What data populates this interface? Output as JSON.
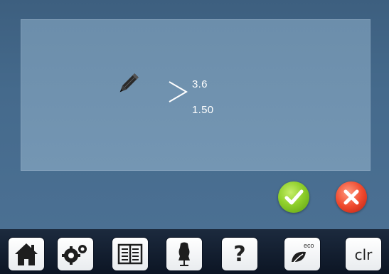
{
  "dialog": {
    "icon": "pencil-icon",
    "separator_icon": "greater-than-icon",
    "value_top": "3.6",
    "value_bottom": "1.50"
  },
  "actions": {
    "confirm_icon": "checkmark-icon",
    "confirm_color": "#8fcf2b",
    "cancel_icon": "x-icon",
    "cancel_color": "#f04a2e"
  },
  "toolbar": {
    "items": [
      {
        "name": "home",
        "icon": "house-icon"
      },
      {
        "name": "setup",
        "icon": "gears-icon"
      },
      {
        "name": "tutorial",
        "icon": "book-icon"
      },
      {
        "name": "consultant",
        "icon": "dress-form-icon"
      },
      {
        "name": "help",
        "icon": "question-icon",
        "label": "?"
      },
      {
        "name": "eco",
        "icon": "leaf-icon",
        "label": "eco"
      },
      {
        "name": "clear",
        "icon": "clear-icon",
        "label": "clr"
      }
    ]
  }
}
